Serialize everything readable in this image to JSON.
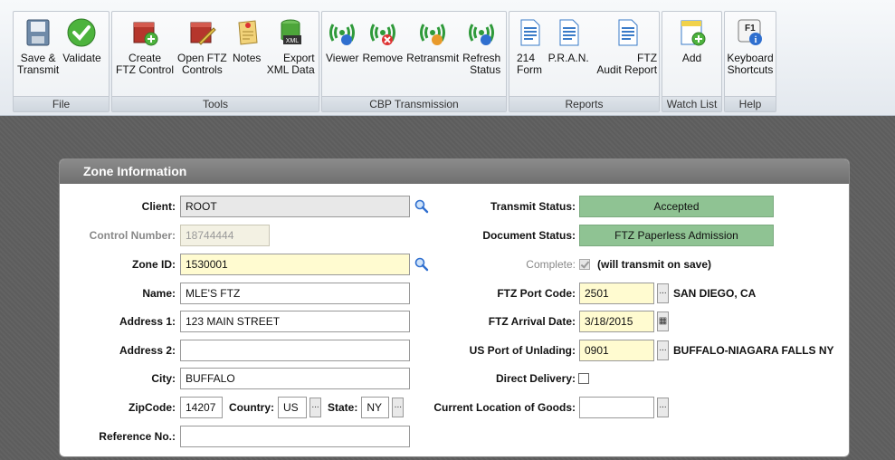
{
  "ribbon": {
    "groups": [
      {
        "label": "File",
        "buttons": [
          {
            "label": "Save &\nTransmit"
          },
          {
            "label": "Validate"
          }
        ]
      },
      {
        "label": "Tools",
        "buttons": [
          {
            "label": "Create\nFTZ Control"
          },
          {
            "label": "Open FTZ\nControls"
          },
          {
            "label": "Notes"
          },
          {
            "label": "Export\nXML Data"
          }
        ]
      },
      {
        "label": "CBP Transmission",
        "buttons": [
          {
            "label": "Viewer"
          },
          {
            "label": "Remove"
          },
          {
            "label": "Retransmit"
          },
          {
            "label": "Refresh\nStatus"
          }
        ]
      },
      {
        "label": "Reports",
        "buttons": [
          {
            "label": "214\nForm"
          },
          {
            "label": "P.R.A.N."
          },
          {
            "label": "FTZ\nAudit Report"
          }
        ]
      },
      {
        "label": "Watch List",
        "buttons": [
          {
            "label": "Add"
          }
        ]
      },
      {
        "label": "Help",
        "buttons": [
          {
            "label": "Keyboard\nShortcuts"
          }
        ]
      }
    ]
  },
  "panel": {
    "title": "Zone Information",
    "client": {
      "label": "Client:",
      "value": "ROOT"
    },
    "control_number": {
      "label": "Control Number:",
      "value": "18744444"
    },
    "zone_id": {
      "label": "Zone ID:",
      "value": "1530001"
    },
    "name": {
      "label": "Name:",
      "value": "MLE'S FTZ"
    },
    "address1": {
      "label": "Address 1:",
      "value": "123 MAIN STREET"
    },
    "address2": {
      "label": "Address 2:",
      "value": ""
    },
    "city": {
      "label": "City:",
      "value": "BUFFALO"
    },
    "zipcode": {
      "label": "ZipCode:",
      "value": "14207"
    },
    "country": {
      "label": "Country:",
      "value": "US"
    },
    "state": {
      "label": "State:",
      "value": "NY"
    },
    "reference": {
      "label": "Reference No.:",
      "value": ""
    },
    "transmit_status": {
      "label": "Transmit Status:",
      "value": "Accepted"
    },
    "document_status": {
      "label": "Document Status:",
      "value": "FTZ Paperless Admission"
    },
    "complete": {
      "label": "Complete:",
      "note": "(will transmit on save)"
    },
    "port_code": {
      "label": "FTZ Port Code:",
      "value": "2501",
      "desc": "SAN DIEGO, CA"
    },
    "arrival_date": {
      "label": "FTZ Arrival Date:",
      "value": "3/18/2015"
    },
    "unlading": {
      "label": "US Port of Unlading:",
      "value": "0901",
      "desc": "BUFFALO-NIAGARA FALLS NY"
    },
    "direct_delivery": {
      "label": "Direct Delivery:"
    },
    "location": {
      "label": "Current Location of Goods:",
      "value": ""
    },
    "ellipsis": "..."
  },
  "colors": {
    "accent_status": "#8fc393",
    "required_field": "#fffbd0"
  }
}
